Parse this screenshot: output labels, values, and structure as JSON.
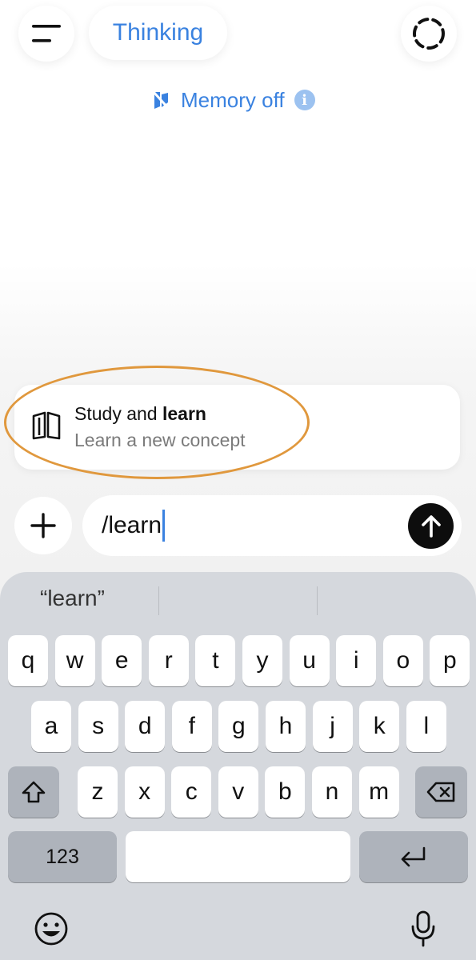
{
  "header": {
    "model_label": "Thinking",
    "memory_label": "Memory off",
    "info_glyph": "i"
  },
  "suggestion": {
    "title_prefix": "Study and ",
    "title_bold": "learn",
    "subtitle": "Learn a new concept",
    "icon": "open-book-icon"
  },
  "composer": {
    "input_value": "/learn"
  },
  "keyboard": {
    "prediction": "“learn”",
    "row1": [
      "q",
      "w",
      "e",
      "r",
      "t",
      "y",
      "u",
      "i",
      "o",
      "p"
    ],
    "row2": [
      "a",
      "s",
      "d",
      "f",
      "g",
      "h",
      "j",
      "k",
      "l"
    ],
    "row3": [
      "z",
      "x",
      "c",
      "v",
      "b",
      "n",
      "m"
    ],
    "numbers_label": "123"
  },
  "colors": {
    "accent": "#3a82e0",
    "highlight": "#e0983d",
    "keyboard_bg": "#d5d8dd"
  }
}
